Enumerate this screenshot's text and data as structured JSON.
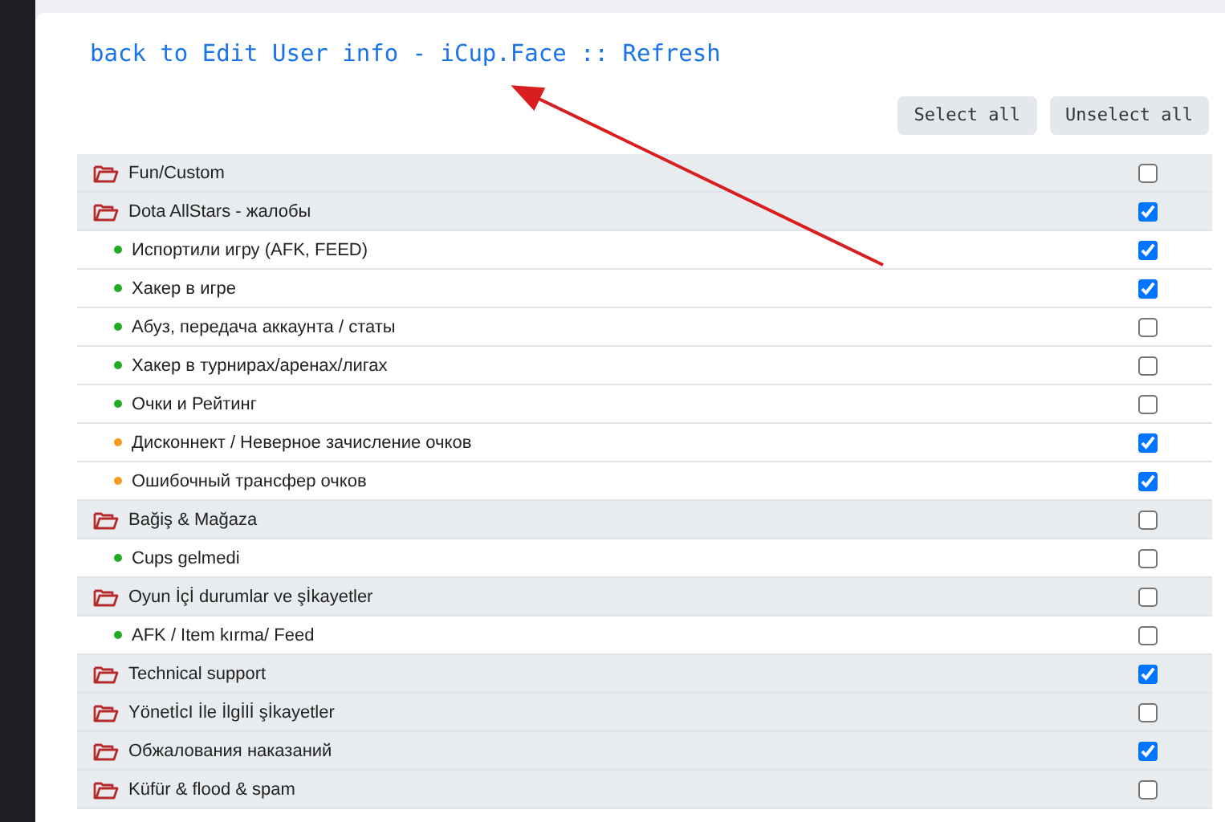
{
  "header": {
    "back_link": "back to Edit User info - iCup.Face",
    "separator": "::",
    "refresh_link": "Refresh"
  },
  "buttons": [
    "Select all",
    "Unselect all"
  ],
  "rows": [
    {
      "kind": "category",
      "label": "Fun/Custom",
      "checked": false
    },
    {
      "kind": "category",
      "label": "Dota AllStars - жалобы",
      "checked": true
    },
    {
      "kind": "item",
      "label": "Испортили игру (AFK, FEED)",
      "checked": true,
      "color": "#22aa22"
    },
    {
      "kind": "item",
      "label": "Хакер в игре",
      "checked": true,
      "color": "#22aa22"
    },
    {
      "kind": "item",
      "label": "Абуз, передача аккаунта / статы",
      "checked": false,
      "color": "#22aa22"
    },
    {
      "kind": "item",
      "label": "Хакер в турнирах/аренах/лигах",
      "checked": false,
      "color": "#22aa22"
    },
    {
      "kind": "item",
      "label": "Очки и Рейтинг",
      "checked": false,
      "color": "#22aa22"
    },
    {
      "kind": "item",
      "label": "Дисконнект / Неверное зачисление очков",
      "checked": true,
      "color": "#f59a23"
    },
    {
      "kind": "item",
      "label": "Ошибочный трансфер очков",
      "checked": true,
      "color": "#f59a23"
    },
    {
      "kind": "category",
      "label": "Bağiş & Mağaza",
      "checked": false
    },
    {
      "kind": "item",
      "label": "Cups gelmedi",
      "checked": false,
      "color": "#22aa22"
    },
    {
      "kind": "category",
      "label": "Oyun İçİ durumlar ve şİkayetler",
      "checked": false
    },
    {
      "kind": "item",
      "label": "AFK / Item kırma/ Feed",
      "checked": false,
      "color": "#22aa22"
    },
    {
      "kind": "category",
      "label": "Technical support",
      "checked": true
    },
    {
      "kind": "category",
      "label": "YönetİcI İle İlgİlİ şİkayetler",
      "checked": false
    },
    {
      "kind": "category",
      "label": "Обжалования наказаний",
      "checked": true
    },
    {
      "kind": "category",
      "label": "Küfür & flood & spam",
      "checked": false
    }
  ]
}
